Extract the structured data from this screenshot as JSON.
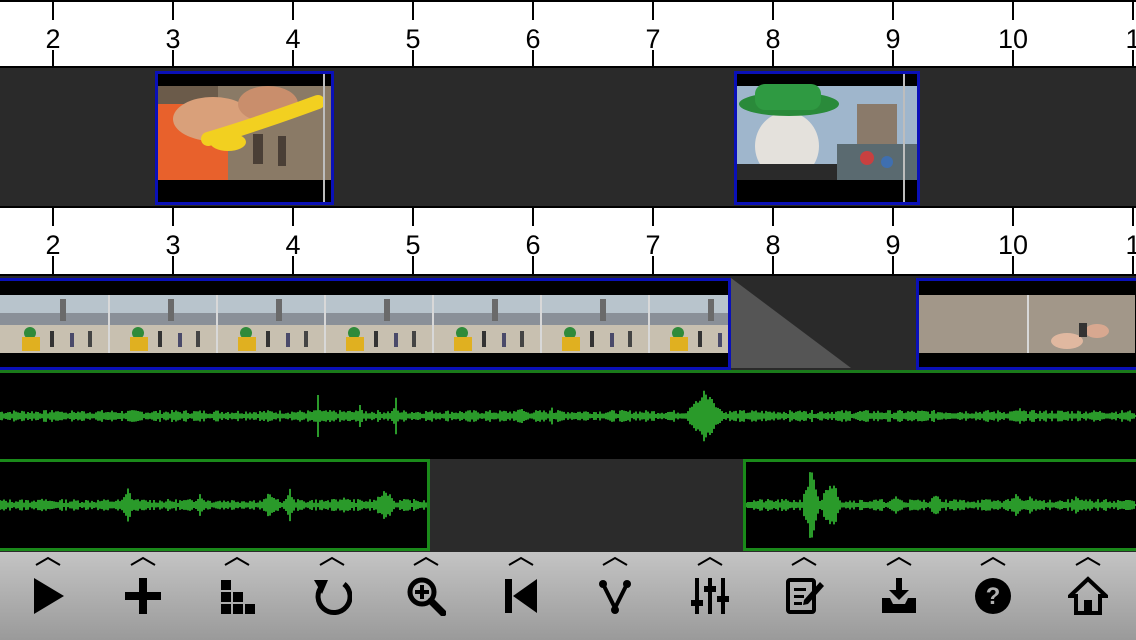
{
  "ruler": {
    "labels": [
      "2",
      "3",
      "4",
      "5",
      "6",
      "7",
      "8",
      "9",
      "10",
      "1"
    ]
  },
  "overlay_track": {
    "clips": [
      {
        "name": "balloon-clip",
        "scene": "hands shaping a yellow balloon"
      },
      {
        "name": "mime-clip",
        "scene": "mime in green hat"
      }
    ]
  },
  "main_track": {
    "clips": [
      {
        "name": "riverfront-filmstrip"
      },
      {
        "name": "ground-hands-filmstrip"
      }
    ]
  },
  "audio_tracks": [
    {
      "name": "audio-track-1"
    },
    {
      "name": "audio-track-2"
    }
  ],
  "toolbar": {
    "buttons": [
      {
        "name": "play-button",
        "icon": "play-icon"
      },
      {
        "name": "add-button",
        "icon": "plus-icon"
      },
      {
        "name": "arrange-button",
        "icon": "blocks-icon"
      },
      {
        "name": "undo-button",
        "icon": "undo-icon"
      },
      {
        "name": "zoom-button",
        "icon": "zoom-in-icon"
      },
      {
        "name": "skip-start-button",
        "icon": "skip-back-icon"
      },
      {
        "name": "transition-button",
        "icon": "split-icon"
      },
      {
        "name": "mixer-button",
        "icon": "sliders-icon"
      },
      {
        "name": "edit-button",
        "icon": "edit-note-icon"
      },
      {
        "name": "export-button",
        "icon": "tray-download-icon"
      },
      {
        "name": "help-button",
        "icon": "help-icon"
      },
      {
        "name": "home-button",
        "icon": "home-icon"
      }
    ]
  },
  "colors": {
    "clip_border": "#0a10b8",
    "audio_wave": "#2a9a2a",
    "track_bg": "#2a2a2a"
  }
}
